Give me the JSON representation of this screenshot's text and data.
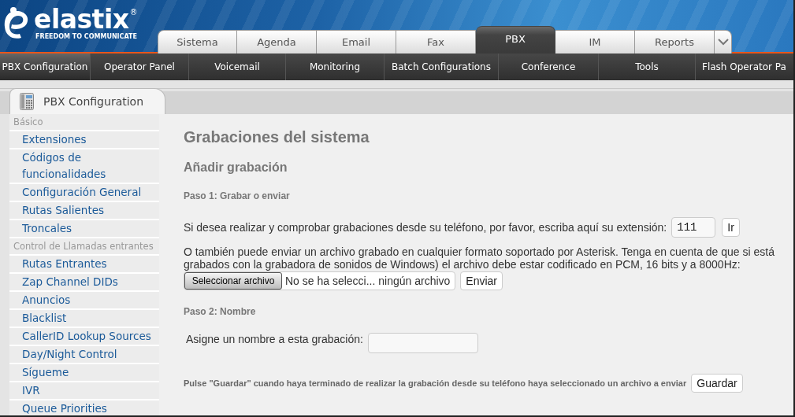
{
  "header": {
    "logo": "elastix",
    "logo_mark": "®",
    "tagline": "FREEDOM TO COMMUNICATE"
  },
  "top_tabs": [
    {
      "label": "Sistema",
      "selected": false
    },
    {
      "label": "Agenda",
      "selected": false
    },
    {
      "label": "Email",
      "selected": false
    },
    {
      "label": "Fax",
      "selected": false
    },
    {
      "label": "PBX",
      "selected": true
    },
    {
      "label": "IM",
      "selected": false
    },
    {
      "label": "Reports",
      "selected": false
    }
  ],
  "menu": [
    {
      "label": "PBX Configuration",
      "selected": true
    },
    {
      "label": "Operator Panel",
      "selected": false
    },
    {
      "label": "Voicemail",
      "selected": false
    },
    {
      "label": "Monitoring",
      "selected": false
    },
    {
      "label": "Batch Configurations",
      "selected": false
    },
    {
      "label": "Conference",
      "selected": false
    },
    {
      "label": "Tools",
      "selected": false
    },
    {
      "label": "Flash Operator Pa",
      "selected": false
    }
  ],
  "panel_tab": {
    "label": "PBX Configuration"
  },
  "sidebar": {
    "groups": [
      {
        "heading": "Básico",
        "items": [
          "Extensiones",
          "Códigos de funcionalidades",
          "Configuración General",
          "Rutas Salientes",
          "Troncales"
        ]
      },
      {
        "heading": "Control de Llamadas entrantes",
        "items": [
          "Rutas Entrantes",
          "Zap Channel DIDs",
          "Anuncios",
          "Blacklist",
          "CallerID Lookup Sources",
          "Day/Night Control",
          "Sígueme",
          "IVR",
          "Queue Priorities"
        ]
      }
    ]
  },
  "content": {
    "title": "Grabaciones del sistema",
    "subtitle": "Añadir grabación",
    "step1": {
      "heading": "Paso 1: Grabar o enviar",
      "phone_text": "Si desea realizar y comprobar grabaciones desde su teléfono, por favor, escriba aquí su extensión:",
      "extension_value": "111",
      "go_button": "Ir",
      "upload_lines": [
        "O también puede enviar un archivo grabado en cualquier formato soportado por Asterisk. Tenga en cuenta de que si está",
        "grabados con la grabadora de sonidos de Windows) el archivo debe estar codificado en PCM, 16 bits y a 8000Hz:"
      ],
      "file_button": "Seleccionar archivo",
      "file_status": "No se ha selecci... ningún archivo",
      "send_button": "Enviar"
    },
    "step2": {
      "heading": "Paso 2: Nombre",
      "name_label": "Asigne un nombre a esta grabación:"
    },
    "footer_text": "Pulse \"Guardar\" cuando haya terminado de realizar la grabación desde su teléfono haya seleccionado un archivo a enviar",
    "save_button": "Guardar"
  }
}
